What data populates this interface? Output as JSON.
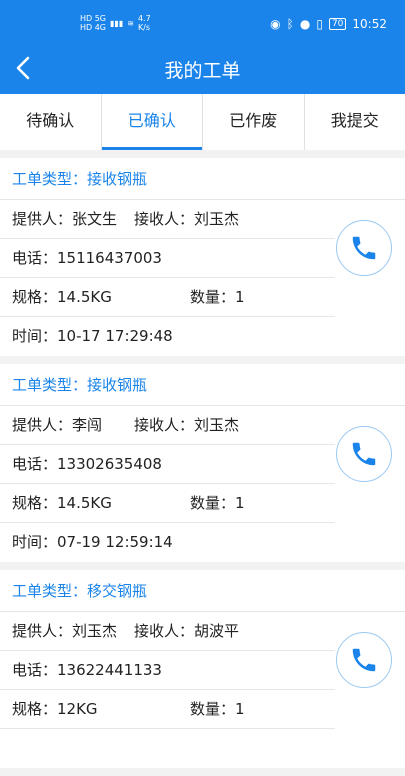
{
  "status": {
    "net_top": "HD 5G",
    "net_bottom": "HD 4G",
    "speed": "4.7\nK/s",
    "battery": "70",
    "time": "10:52"
  },
  "app": {
    "title": "我的工单"
  },
  "tabs": [
    {
      "label": "待确认"
    },
    {
      "label": "已确认"
    },
    {
      "label": "已作废"
    },
    {
      "label": "我提交"
    }
  ],
  "active_tab": "已确认",
  "orders": [
    {
      "type": "工单类型：接收钢瓶",
      "provider": "提供人：张文生",
      "receiver": "接收人：刘玉杰",
      "phone": "电话：15116437003",
      "spec": "规格：14.5KG",
      "qty": "数量：1",
      "time": "时间：10-17 17:29:48"
    },
    {
      "type": "工单类型：接收钢瓶",
      "provider": "提供人：李闯",
      "receiver": "接收人：刘玉杰",
      "phone": "电话：13302635408",
      "spec": "规格：14.5KG",
      "qty": "数量：1",
      "time": "时间：07-19 12:59:14"
    },
    {
      "type": "工单类型：移交钢瓶",
      "provider": "提供人：刘玉杰",
      "receiver": "接收人：胡波平",
      "phone": "电话：13622441133",
      "spec": "规格：12KG",
      "qty": "数量：1",
      "time": ""
    }
  ],
  "colors": {
    "accent": "#1a84ea"
  }
}
